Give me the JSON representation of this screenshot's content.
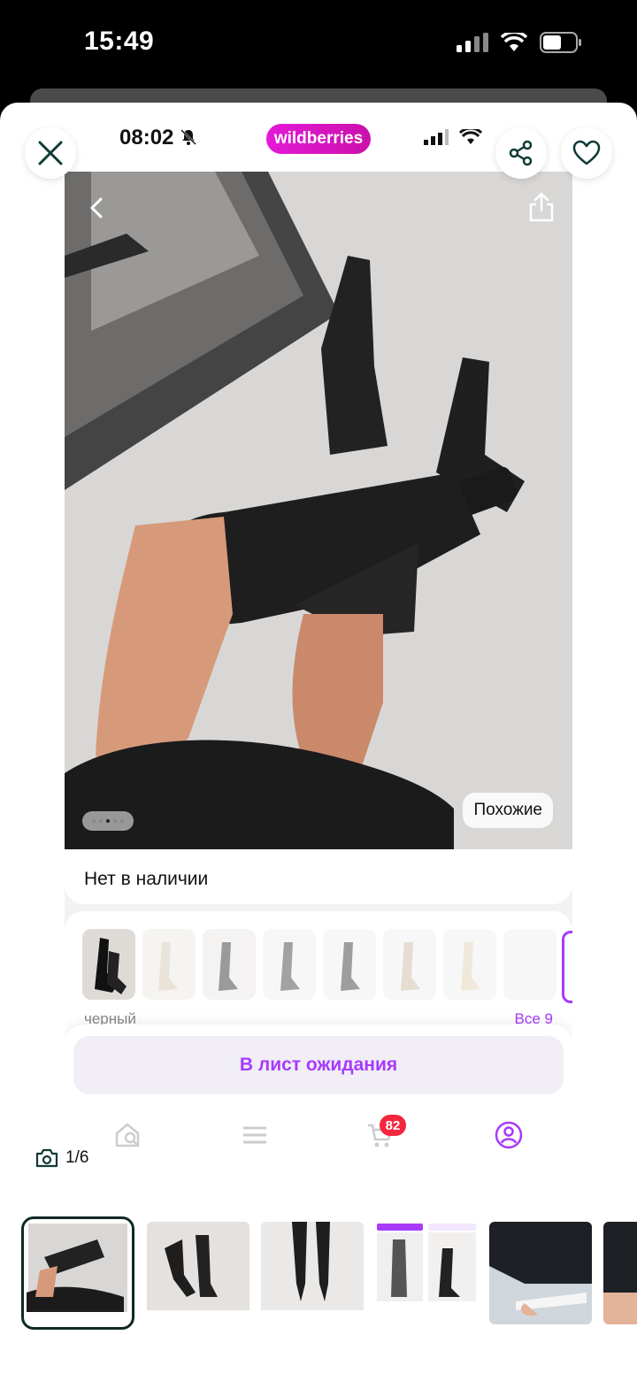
{
  "status_bar": {
    "time": "15:49"
  },
  "inner_screenshot": {
    "time": "08:02",
    "logo": "wildberries",
    "out_of_stock": "Нет в наличии",
    "similar_label": "Похожие",
    "color_name": "черный",
    "all_colors_link": "Все 9",
    "wait_list_button": "В лист ожидания",
    "cart_badge": "82",
    "photo_dots": {
      "count": 5,
      "active": 2
    }
  },
  "viewer": {
    "counter": "1/6",
    "close_icon": "close-icon",
    "share_icon": "share-icon",
    "favorite_icon": "heart-icon"
  },
  "colors": {
    "accent": "#a73afd",
    "brand": "#cb11ab",
    "badge": "#f4263e"
  }
}
